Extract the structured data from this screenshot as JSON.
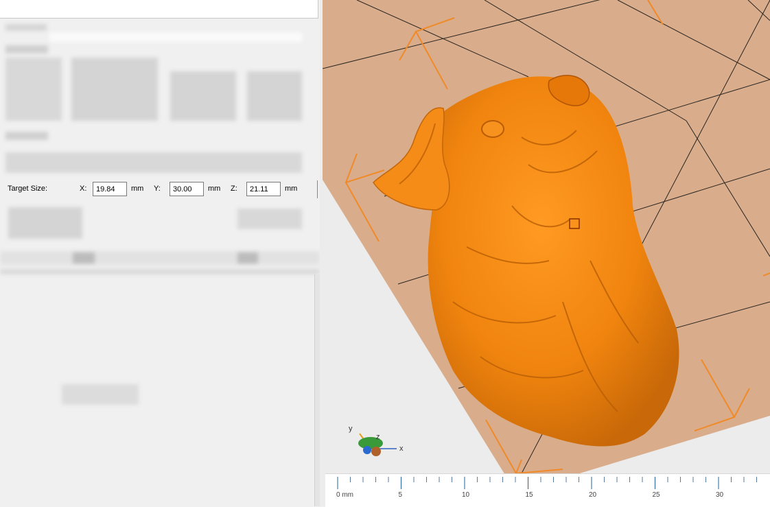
{
  "target_size": {
    "label": "Target Size:",
    "x_label": "X:",
    "x_value": "19.84",
    "y_label": "Y:",
    "y_value": "30.00",
    "z_label": "Z:",
    "z_value": "21.11",
    "unit": "mm"
  },
  "axis_gizmo": {
    "x": "x",
    "y": "y",
    "z": "z"
  },
  "ruler": {
    "ticks": [
      "0 mm",
      "5",
      "10",
      "15",
      "20",
      "25",
      "30"
    ]
  },
  "colors": {
    "model": "#f58a12",
    "bed": "#d9ac8a",
    "bounding_box": "#f08a28",
    "panel": "#f0f0f0"
  }
}
